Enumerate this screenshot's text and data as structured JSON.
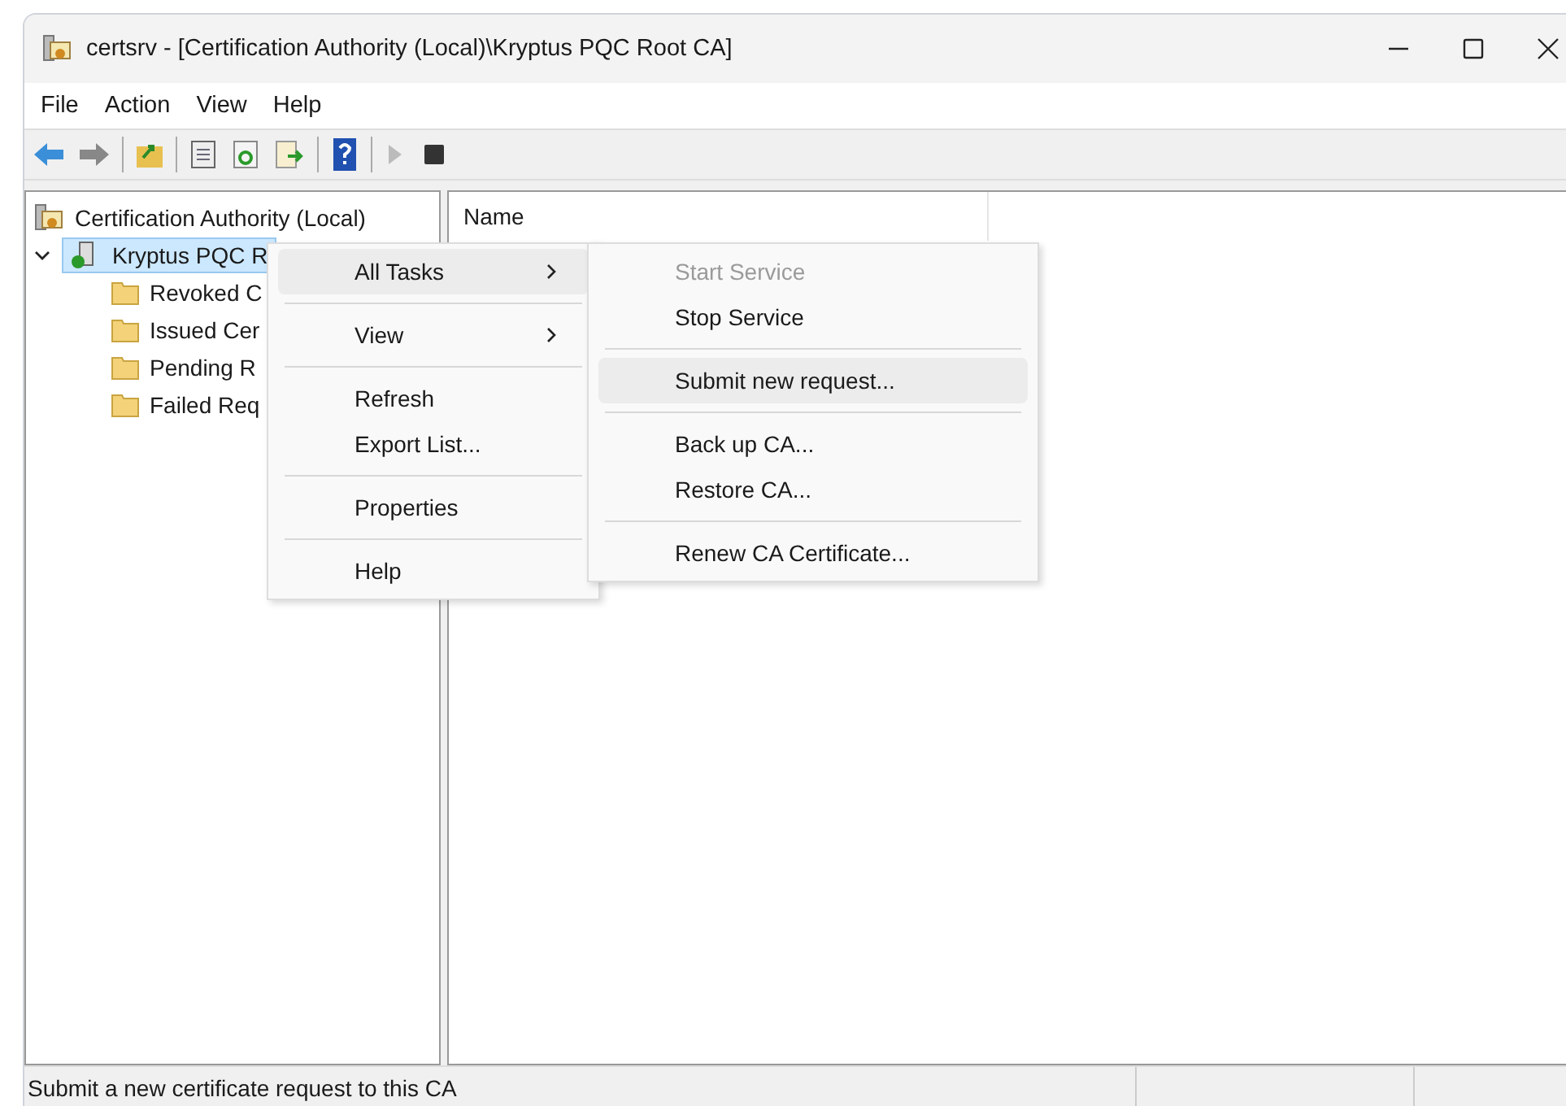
{
  "window": {
    "title": "certsrv - [Certification Authority (Local)\\Kryptus PQC Root CA]"
  },
  "menu_bar": [
    "File",
    "Action",
    "View",
    "Help"
  ],
  "tree": {
    "label": "Certification Authority (Local)",
    "children": [
      {
        "label": "Kryptus PQC R",
        "selected": true,
        "expanded": true,
        "children": [
          {
            "label": "Revoked C"
          },
          {
            "label": "Issued Cer"
          },
          {
            "label": "Pending R"
          },
          {
            "label": "Failed Req"
          }
        ]
      }
    ]
  },
  "list": {
    "columns": [
      "Name"
    ]
  },
  "context_menu": {
    "groups": [
      [
        {
          "label": "All Tasks",
          "submenu": true,
          "selected": true
        }
      ],
      [
        {
          "label": "View",
          "submenu": true,
          "selected": false
        }
      ],
      [
        {
          "label": "Refresh",
          "submenu": false,
          "selected": false
        },
        {
          "label": "Export List...",
          "submenu": false,
          "selected": false
        }
      ],
      [
        {
          "label": "Properties",
          "submenu": false,
          "selected": false
        }
      ],
      [
        {
          "label": "Help",
          "submenu": false,
          "selected": false
        }
      ]
    ]
  },
  "submenu": {
    "groups": [
      [
        {
          "label": "Start Service",
          "disabled": true,
          "selected": false
        },
        {
          "label": "Stop Service",
          "disabled": false,
          "selected": false
        }
      ],
      [
        {
          "label": "Submit new request...",
          "disabled": false,
          "selected": true
        }
      ],
      [
        {
          "label": "Back up CA...",
          "disabled": false,
          "selected": false
        },
        {
          "label": "Restore CA...",
          "disabled": false,
          "selected": false
        }
      ],
      [
        {
          "label": "Renew CA Certificate...",
          "disabled": false,
          "selected": false
        }
      ]
    ]
  },
  "status_bar": {
    "text": "Submit a new certificate request to this CA"
  }
}
